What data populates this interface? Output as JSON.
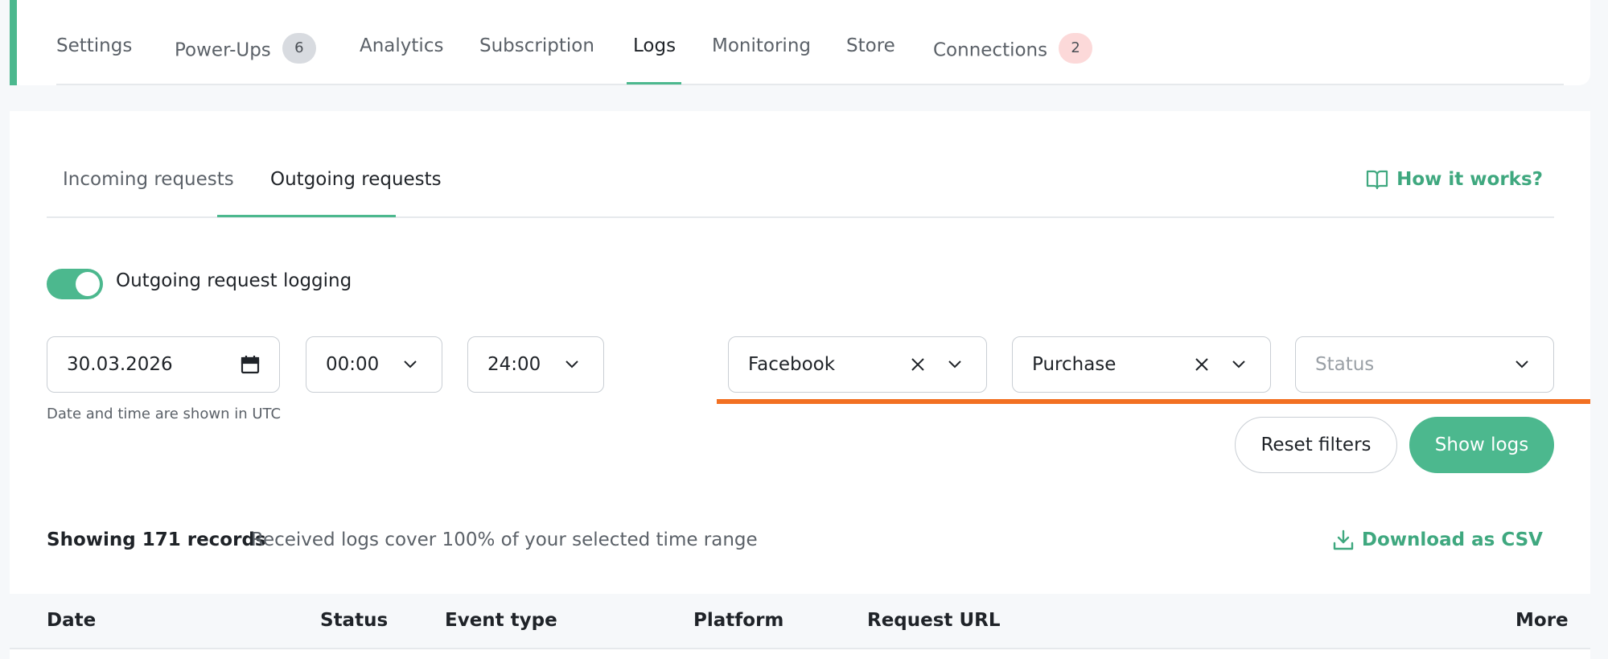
{
  "main_tabs": [
    {
      "label": "Settings"
    },
    {
      "label": "Power-Ups",
      "badge": "6"
    },
    {
      "label": "Analytics"
    },
    {
      "label": "Subscription"
    },
    {
      "label": "Logs"
    },
    {
      "label": "Monitoring"
    },
    {
      "label": "Store"
    },
    {
      "label": "Connections",
      "badge": "2"
    }
  ],
  "active_main_tab": "Logs",
  "sub_tabs": [
    {
      "label": "Incoming requests"
    },
    {
      "label": "Outgoing requests"
    }
  ],
  "active_sub_tab": "Outgoing requests",
  "how_it_works": {
    "label": "How it works?",
    "icon": "book-icon"
  },
  "logging_toggle": {
    "label": "Outgoing request logging",
    "enabled": true
  },
  "filters": {
    "date": "30.03.2026",
    "time_from": "00:00",
    "time_to": "24:00",
    "platform": "Facebook",
    "event_type": "Purchase",
    "status_placeholder": "Status",
    "hint": "Date and time are shown in UTC"
  },
  "buttons": {
    "reset": "Reset filters",
    "show": "Show logs"
  },
  "summary": {
    "showing": "Showing 171 records",
    "coverage": "Received logs cover 100% of your selected time range"
  },
  "download_csv": {
    "label": "Download as CSV",
    "icon": "download-icon"
  },
  "table": {
    "columns": [
      "Date",
      "Status",
      "Event type",
      "Platform",
      "Request URL",
      "More"
    ]
  },
  "colors": {
    "accent": "#4cb88e",
    "link": "#3fa87f",
    "highlight": "#f27022",
    "badge_gray": "#d8dbe0",
    "badge_pink": "#fcd9d9"
  }
}
